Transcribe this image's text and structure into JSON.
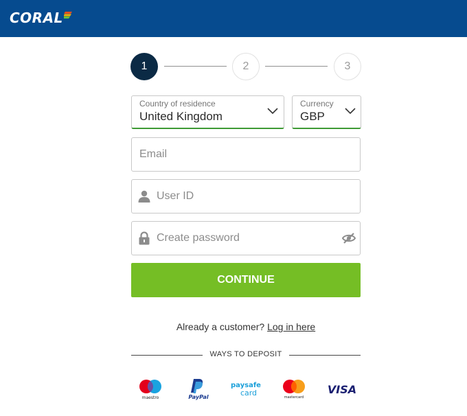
{
  "header": {
    "logo_text": "CORAL"
  },
  "stepper": {
    "steps": [
      "1",
      "2",
      "3"
    ],
    "active_step": 1
  },
  "form": {
    "country": {
      "label": "Country of residence",
      "value": "United Kingdom"
    },
    "currency": {
      "label": "Currency",
      "value": "GBP"
    },
    "email": {
      "placeholder": "Email"
    },
    "user_id": {
      "placeholder": "User ID"
    },
    "password": {
      "placeholder": "Create password"
    },
    "continue_label": "CONTINUE"
  },
  "login": {
    "prompt": "Already a customer?",
    "link": "Log in here"
  },
  "deposit": {
    "title": "WAYS TO DEPOSIT",
    "methods": [
      {
        "name": "maestro",
        "label": "maestro"
      },
      {
        "name": "paypal",
        "label": "PayPal"
      },
      {
        "name": "paysafecard",
        "label_top": "paysafe",
        "label_bottom": "card"
      },
      {
        "name": "mastercard",
        "label": "mastercard"
      },
      {
        "name": "visa",
        "label": "VISA"
      }
    ]
  },
  "colors": {
    "header_bg": "#064b8f",
    "primary_button": "#75be25",
    "active_step": "#0b2a45",
    "valid_underline": "#3e9a34"
  }
}
